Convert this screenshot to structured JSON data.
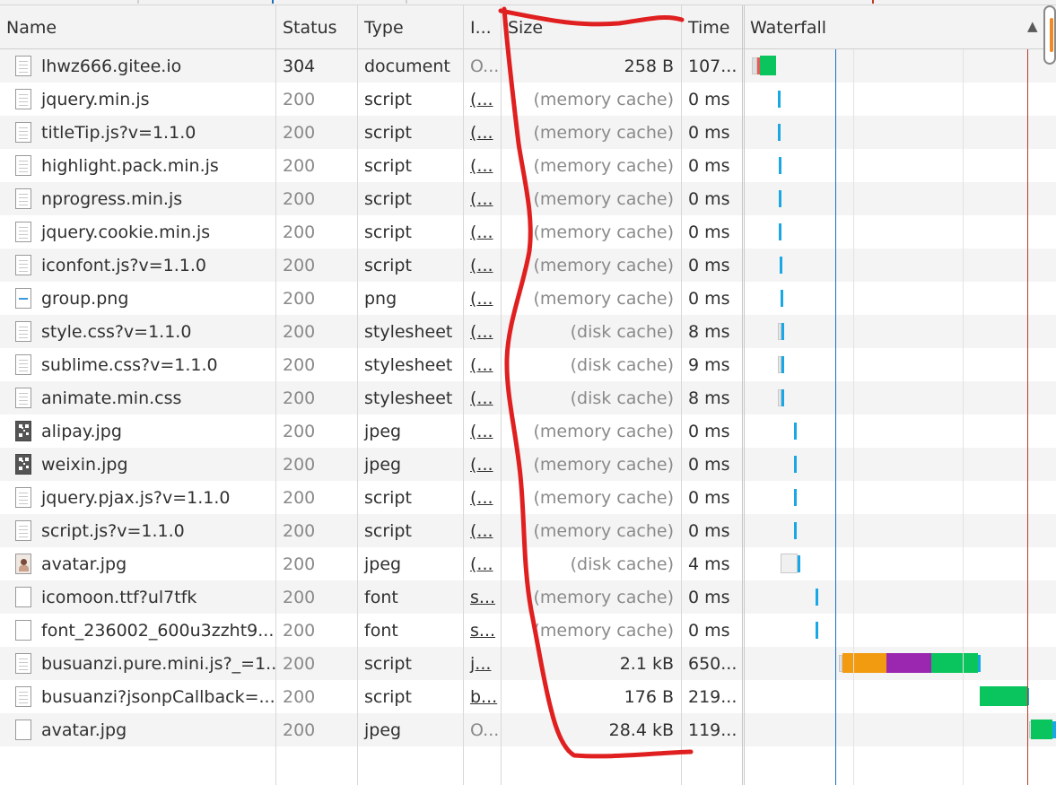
{
  "columns": {
    "name": "Name",
    "status": "Status",
    "type": "Type",
    "initiator": "I...",
    "size": "Size",
    "time": "Time",
    "waterfall": "Waterfall"
  },
  "rows": [
    {
      "name": "lhwz666.gitee.io",
      "status": "304",
      "type": "document",
      "initiator": "O...",
      "size": "258 B",
      "time": "107...",
      "icon": "document-icon"
    },
    {
      "name": "jquery.min.js",
      "status": "200",
      "type": "script",
      "initiator": "(...",
      "size": "(memory cache)",
      "time": "0 ms",
      "icon": "document-icon"
    },
    {
      "name": "titleTip.js?v=1.1.0",
      "status": "200",
      "type": "script",
      "initiator": "(...",
      "size": "(memory cache)",
      "time": "0 ms",
      "icon": "document-icon"
    },
    {
      "name": "highlight.pack.min.js",
      "status": "200",
      "type": "script",
      "initiator": "(...",
      "size": "(memory cache)",
      "time": "0 ms",
      "icon": "document-icon"
    },
    {
      "name": "nprogress.min.js",
      "status": "200",
      "type": "script",
      "initiator": "(...",
      "size": "(memory cache)",
      "time": "0 ms",
      "icon": "document-icon"
    },
    {
      "name": "jquery.cookie.min.js",
      "status": "200",
      "type": "script",
      "initiator": "(...",
      "size": "(memory cache)",
      "time": "0 ms",
      "icon": "document-icon"
    },
    {
      "name": "iconfont.js?v=1.1.0",
      "status": "200",
      "type": "script",
      "initiator": "(...",
      "size": "(memory cache)",
      "time": "0 ms",
      "icon": "document-icon"
    },
    {
      "name": "group.png",
      "status": "200",
      "type": "png",
      "initiator": "(...",
      "size": "(memory cache)",
      "time": "0 ms",
      "icon": "png-icon"
    },
    {
      "name": "style.css?v=1.1.0",
      "status": "200",
      "type": "stylesheet",
      "initiator": "(...",
      "size": "(disk cache)",
      "time": "8 ms",
      "icon": "document-icon"
    },
    {
      "name": "sublime.css?v=1.1.0",
      "status": "200",
      "type": "stylesheet",
      "initiator": "(...",
      "size": "(disk cache)",
      "time": "9 ms",
      "icon": "document-icon"
    },
    {
      "name": "animate.min.css",
      "status": "200",
      "type": "stylesheet",
      "initiator": "(...",
      "size": "(disk cache)",
      "time": "8 ms",
      "icon": "document-icon"
    },
    {
      "name": "alipay.jpg",
      "status": "200",
      "type": "jpeg",
      "initiator": "(...",
      "size": "(memory cache)",
      "time": "0 ms",
      "icon": "qr-image-icon"
    },
    {
      "name": "weixin.jpg",
      "status": "200",
      "type": "jpeg",
      "initiator": "(...",
      "size": "(memory cache)",
      "time": "0 ms",
      "icon": "qr-image-icon"
    },
    {
      "name": "jquery.pjax.js?v=1.1.0",
      "status": "200",
      "type": "script",
      "initiator": "(...",
      "size": "(memory cache)",
      "time": "0 ms",
      "icon": "document-icon"
    },
    {
      "name": "script.js?v=1.1.0",
      "status": "200",
      "type": "script",
      "initiator": "(...",
      "size": "(memory cache)",
      "time": "0 ms",
      "icon": "document-icon"
    },
    {
      "name": "avatar.jpg",
      "status": "200",
      "type": "jpeg",
      "initiator": "(...",
      "size": "(disk cache)",
      "time": "4 ms",
      "icon": "avatar-image-icon"
    },
    {
      "name": "icomoon.ttf?ul7tfk",
      "status": "200",
      "type": "font",
      "initiator": "s...",
      "size": "(memory cache)",
      "time": "0 ms",
      "icon": "blank-file-icon"
    },
    {
      "name": "font_236002_600u3zzht9...",
      "status": "200",
      "type": "font",
      "initiator": "s...",
      "size": "(memory cache)",
      "time": "0 ms",
      "icon": "blank-file-icon"
    },
    {
      "name": "busuanzi.pure.mini.js?_=1...",
      "status": "200",
      "type": "script",
      "initiator": "j...",
      "size": "2.1 kB",
      "time": "650...",
      "icon": "document-icon"
    },
    {
      "name": "busuanzi?jsonpCallback=...",
      "status": "200",
      "type": "script",
      "initiator": "b...",
      "size": "176 B",
      "time": "219...",
      "icon": "document-icon"
    },
    {
      "name": "avatar.jpg",
      "status": "200",
      "type": "jpeg",
      "initiator": "O...",
      "size": "28.4 kB",
      "time": "119...",
      "icon": "blank-file-icon"
    }
  ],
  "colors": {
    "waiting": "#f29b11",
    "ssl": "#9b27b0",
    "download": "#0ac45e",
    "cached": "#1aa7e6",
    "dom_content_loaded_line": "#1f6fbf",
    "load_line": "#c0392b",
    "annotation": "#e02020"
  }
}
